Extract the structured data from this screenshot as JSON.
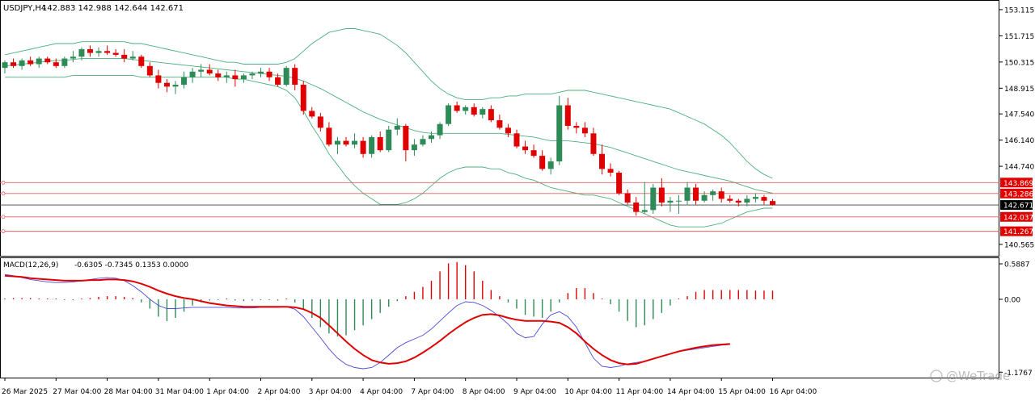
{
  "header": {
    "symbol": "USDJPY,H4",
    "ohlc": "142.883 142.988 142.644 142.671",
    "macd_label": "MACD(12,26,9)",
    "macd_values": "-0.6305 -0.7345 0.1353 0.0000"
  },
  "watermark": "@WeTrade",
  "colors": {
    "bull": "#2e8b57",
    "bear": "#e00000",
    "band": "#4caf7d",
    "signal": "#e00000",
    "macd_line": "#4a4ad8",
    "hline": "#e06060",
    "current_line": "#404040",
    "tag_bg": "#e00000",
    "current_tag_bg": "#000000",
    "grid": "#000000"
  },
  "chart_data": [
    {
      "type": "candlestick",
      "title": "USDJPY,H4",
      "ylim": [
        140.0,
        153.5
      ],
      "y_ticks": [
        "153.115",
        "151.715",
        "150.315",
        "148.915",
        "147.540",
        "146.140",
        "144.740",
        "140.565"
      ],
      "y_tick_values": [
        153.115,
        151.715,
        150.315,
        148.915,
        147.54,
        146.14,
        144.74,
        140.565
      ],
      "x_ticks": [
        "26 Mar 2025",
        "27 Mar 04:00",
        "28 Mar 04:00",
        "31 Mar 04:00",
        "1 Apr 04:00",
        "2 Apr 04:00",
        "3 Apr 04:00",
        "4 Apr 04:00",
        "7 Apr 04:00",
        "8 Apr 04:00",
        "9 Apr 04:00",
        "10 Apr 04:00",
        "11 Apr 04:00",
        "14 Apr 04:00",
        "15 Apr 04:00",
        "16 Apr 04:00"
      ],
      "x_tick_index": [
        0,
        6,
        12,
        18,
        24,
        30,
        36,
        42,
        48,
        54,
        60,
        66,
        72,
        78,
        84,
        90
      ],
      "ohlc": [
        [
          150.0,
          150.4,
          149.7,
          150.3
        ],
        [
          150.3,
          150.5,
          150.0,
          150.1
        ],
        [
          150.1,
          150.5,
          149.9,
          150.4
        ],
        [
          150.4,
          150.6,
          150.1,
          150.2
        ],
        [
          150.2,
          150.6,
          150.0,
          150.5
        ],
        [
          150.5,
          150.6,
          150.2,
          150.3
        ],
        [
          150.3,
          150.5,
          150.0,
          150.1
        ],
        [
          150.1,
          150.6,
          150.0,
          150.5
        ],
        [
          150.5,
          150.9,
          150.3,
          150.6
        ],
        [
          150.6,
          151.1,
          150.4,
          151.0
        ],
        [
          151.0,
          151.2,
          150.6,
          150.8
        ],
        [
          150.8,
          151.1,
          150.6,
          150.9
        ],
        [
          150.9,
          151.2,
          150.7,
          150.8
        ],
        [
          150.8,
          151.0,
          150.6,
          150.7
        ],
        [
          150.7,
          151.0,
          150.3,
          150.5
        ],
        [
          150.5,
          150.9,
          150.4,
          150.6
        ],
        [
          150.6,
          150.7,
          150.0,
          150.1
        ],
        [
          150.1,
          150.3,
          149.5,
          149.6
        ],
        [
          149.6,
          149.9,
          148.9,
          149.2
        ],
        [
          149.2,
          149.4,
          148.7,
          149.0
        ],
        [
          149.0,
          149.3,
          148.6,
          149.1
        ],
        [
          149.1,
          149.8,
          148.9,
          149.5
        ],
        [
          149.5,
          150.0,
          149.2,
          149.8
        ],
        [
          149.8,
          150.2,
          149.5,
          149.9
        ],
        [
          149.9,
          150.2,
          149.6,
          149.7
        ],
        [
          149.7,
          149.9,
          149.3,
          149.5
        ],
        [
          149.5,
          149.8,
          149.2,
          149.6
        ],
        [
          149.6,
          149.9,
          149.0,
          149.4
        ],
        [
          149.4,
          149.7,
          149.2,
          149.6
        ],
        [
          149.6,
          149.8,
          149.4,
          149.7
        ],
        [
          149.7,
          150.0,
          149.5,
          149.8
        ],
        [
          149.8,
          150.0,
          149.3,
          149.5
        ],
        [
          149.5,
          149.7,
          149.0,
          149.1
        ],
        [
          149.1,
          150.1,
          149.0,
          150.0
        ],
        [
          150.0,
          150.2,
          148.8,
          149.1
        ],
        [
          149.1,
          149.3,
          147.5,
          147.7
        ],
        [
          147.7,
          147.9,
          147.3,
          147.4
        ],
        [
          147.4,
          147.6,
          146.6,
          146.8
        ],
        [
          146.8,
          147.1,
          145.8,
          145.9
        ],
        [
          145.9,
          146.3,
          145.4,
          146.1
        ],
        [
          146.1,
          146.3,
          145.8,
          145.9
        ],
        [
          145.9,
          146.5,
          145.7,
          146.1
        ],
        [
          146.1,
          146.3,
          145.2,
          145.4
        ],
        [
          145.4,
          146.4,
          145.2,
          146.3
        ],
        [
          146.3,
          146.6,
          145.5,
          145.6
        ],
        [
          145.6,
          146.9,
          145.5,
          146.7
        ],
        [
          146.7,
          147.3,
          146.4,
          146.9
        ],
        [
          146.9,
          147.0,
          145.0,
          145.6
        ],
        [
          145.6,
          146.2,
          145.3,
          145.9
        ],
        [
          145.9,
          146.4,
          145.8,
          146.2
        ],
        [
          146.2,
          146.6,
          146.0,
          146.4
        ],
        [
          146.4,
          147.1,
          146.2,
          147.0
        ],
        [
          147.0,
          148.1,
          146.9,
          148.0
        ],
        [
          148.0,
          148.2,
          147.6,
          147.7
        ],
        [
          147.7,
          148.0,
          147.5,
          147.9
        ],
        [
          147.9,
          148.1,
          147.4,
          147.5
        ],
        [
          147.5,
          147.9,
          147.3,
          147.8
        ],
        [
          147.8,
          148.0,
          147.1,
          147.2
        ],
        [
          147.2,
          147.5,
          146.7,
          146.8
        ],
        [
          146.8,
          147.0,
          146.3,
          146.5
        ],
        [
          146.5,
          146.7,
          145.7,
          145.8
        ],
        [
          145.8,
          146.1,
          145.4,
          145.6
        ],
        [
          145.6,
          145.9,
          145.2,
          145.3
        ],
        [
          145.3,
          145.6,
          144.5,
          144.6
        ],
        [
          144.6,
          145.2,
          144.3,
          145.0
        ],
        [
          145.0,
          148.5,
          144.8,
          148.0
        ],
        [
          148.0,
          148.4,
          146.7,
          146.9
        ],
        [
          146.9,
          147.1,
          146.5,
          146.8
        ],
        [
          146.8,
          147.1,
          146.3,
          146.5
        ],
        [
          146.5,
          146.8,
          145.3,
          145.4
        ],
        [
          145.4,
          145.9,
          144.3,
          144.6
        ],
        [
          144.6,
          144.9,
          144.2,
          144.4
        ],
        [
          144.4,
          144.5,
          143.2,
          143.3
        ],
        [
          143.3,
          143.5,
          142.7,
          142.8
        ],
        [
          142.8,
          143.1,
          142.1,
          142.3
        ],
        [
          142.3,
          143.9,
          142.2,
          142.4
        ],
        [
          142.4,
          143.8,
          142.2,
          143.6
        ],
        [
          143.6,
          144.1,
          142.6,
          142.8
        ],
        [
          142.8,
          143.1,
          142.3,
          142.9
        ],
        [
          142.9,
          143.2,
          142.2,
          142.9
        ],
        [
          142.9,
          143.9,
          142.7,
          143.6
        ],
        [
          143.6,
          143.8,
          142.7,
          142.9
        ],
        [
          142.9,
          143.4,
          142.8,
          143.2
        ],
        [
          143.2,
          143.5,
          142.9,
          143.4
        ],
        [
          143.4,
          143.6,
          142.8,
          143.0
        ],
        [
          143.0,
          143.2,
          142.8,
          142.9
        ],
        [
          142.9,
          143.0,
          142.6,
          142.8
        ],
        [
          142.8,
          143.2,
          142.6,
          143.0
        ],
        [
          143.0,
          143.3,
          142.8,
          143.1
        ],
        [
          143.1,
          143.2,
          142.7,
          142.9
        ],
        [
          142.883,
          142.988,
          142.644,
          142.671
        ]
      ],
      "bollinger_upper": [
        150.7,
        150.8,
        150.9,
        151.0,
        151.1,
        151.2,
        151.3,
        151.3,
        151.3,
        151.4,
        151.4,
        151.4,
        151.4,
        151.4,
        151.4,
        151.3,
        151.3,
        151.2,
        151.1,
        151.0,
        150.9,
        150.8,
        150.7,
        150.6,
        150.5,
        150.4,
        150.3,
        150.3,
        150.2,
        150.2,
        150.2,
        150.2,
        150.2,
        150.3,
        150.5,
        150.9,
        151.3,
        151.6,
        151.9,
        152.0,
        152.1,
        152.1,
        152.0,
        151.9,
        151.8,
        151.5,
        151.2,
        150.8,
        150.3,
        149.8,
        149.3,
        148.9,
        148.6,
        148.4,
        148.3,
        148.3,
        148.3,
        148.4,
        148.4,
        148.5,
        148.5,
        148.6,
        148.6,
        148.6,
        148.6,
        148.7,
        148.8,
        148.8,
        148.8,
        148.7,
        148.6,
        148.5,
        148.4,
        148.3,
        148.2,
        148.1,
        148.0,
        147.9,
        147.8,
        147.6,
        147.4,
        147.2,
        147.0,
        146.7,
        146.4,
        146.0,
        145.5,
        145.0,
        144.6,
        144.3,
        144.1
      ],
      "bollinger_mid": [
        150.1,
        150.15,
        150.2,
        150.25,
        150.3,
        150.35,
        150.4,
        150.4,
        150.45,
        150.5,
        150.5,
        150.5,
        150.5,
        150.5,
        150.5,
        150.45,
        150.4,
        150.35,
        150.3,
        150.25,
        150.2,
        150.15,
        150.1,
        150.05,
        150.0,
        149.95,
        149.9,
        149.85,
        149.8,
        149.75,
        149.7,
        149.65,
        149.6,
        149.55,
        149.45,
        149.3,
        149.1,
        148.9,
        148.65,
        148.4,
        148.15,
        147.9,
        147.65,
        147.45,
        147.25,
        147.1,
        146.95,
        146.8,
        146.65,
        146.55,
        146.5,
        146.5,
        146.5,
        146.5,
        146.5,
        146.5,
        146.5,
        146.5,
        146.5,
        146.45,
        146.4,
        146.35,
        146.3,
        146.2,
        146.1,
        146.1,
        146.1,
        146.05,
        146.0,
        145.95,
        145.85,
        145.75,
        145.6,
        145.45,
        145.3,
        145.15,
        145.0,
        144.85,
        144.7,
        144.55,
        144.45,
        144.35,
        144.25,
        144.15,
        144.05,
        143.95,
        143.8,
        143.65,
        143.5,
        143.4,
        143.3
      ],
      "bollinger_lower": [
        149.5,
        149.5,
        149.5,
        149.5,
        149.5,
        149.5,
        149.5,
        149.5,
        149.6,
        149.6,
        149.6,
        149.6,
        149.6,
        149.6,
        149.6,
        149.6,
        149.5,
        149.5,
        149.5,
        149.5,
        149.5,
        149.5,
        149.5,
        149.5,
        149.5,
        149.5,
        149.5,
        149.4,
        149.4,
        149.3,
        149.2,
        149.1,
        149.0,
        148.8,
        148.4,
        147.7,
        146.9,
        146.2,
        145.4,
        144.8,
        144.2,
        143.7,
        143.3,
        143.0,
        142.7,
        142.7,
        142.7,
        142.8,
        143.0,
        143.3,
        143.7,
        144.1,
        144.4,
        144.6,
        144.7,
        144.7,
        144.7,
        144.6,
        144.6,
        144.4,
        144.3,
        144.1,
        144.0,
        143.8,
        143.6,
        143.5,
        143.4,
        143.3,
        143.2,
        143.2,
        143.1,
        143.0,
        142.8,
        142.6,
        142.4,
        142.2,
        142.0,
        141.8,
        141.6,
        141.5,
        141.5,
        141.5,
        141.5,
        141.6,
        141.7,
        141.9,
        142.1,
        142.3,
        142.4,
        142.5,
        142.5
      ],
      "horizontal_levels": [
        {
          "label": "143.869",
          "value": 143.869
        },
        {
          "label": "143.286",
          "value": 143.286
        },
        {
          "label": "142.037",
          "value": 142.037
        },
        {
          "label": "141.267",
          "value": 141.267
        }
      ],
      "current_price": {
        "label": "142.671",
        "value": 142.671
      }
    },
    {
      "type": "macd",
      "title": "MACD(12,26,9)",
      "ylim": [
        -1.25,
        0.65
      ],
      "y_ticks": [
        "0.5887",
        "0.00",
        "-1.1767"
      ],
      "y_tick_values": [
        0.5887,
        0.0,
        -1.1767
      ],
      "histogram": [
        0.01,
        0.02,
        0.02,
        0.02,
        0.01,
        0.01,
        0.0,
        -0.01,
        -0.01,
        0.0,
        0.02,
        0.04,
        0.05,
        0.05,
        0.04,
        0.02,
        -0.05,
        -0.15,
        -0.28,
        -0.35,
        -0.3,
        -0.2,
        -0.1,
        -0.05,
        -0.02,
        -0.01,
        0.0,
        -0.02,
        -0.03,
        -0.02,
        -0.01,
        -0.01,
        -0.02,
        0.0,
        -0.05,
        -0.15,
        -0.3,
        -0.45,
        -0.55,
        -0.6,
        -0.58,
        -0.5,
        -0.42,
        -0.32,
        -0.22,
        -0.12,
        -0.03,
        0.05,
        0.12,
        0.2,
        0.3,
        0.45,
        0.58,
        0.6,
        0.55,
        0.45,
        0.3,
        0.15,
        0.05,
        -0.05,
        -0.15,
        -0.25,
        -0.28,
        -0.3,
        -0.2,
        -0.05,
        0.1,
        0.18,
        0.18,
        0.1,
        0.0,
        -0.08,
        -0.2,
        -0.35,
        -0.45,
        -0.42,
        -0.32,
        -0.22,
        -0.1,
        0.0,
        0.05,
        0.12,
        0.15,
        0.15,
        0.15,
        0.15,
        0.15,
        0.15,
        0.14,
        0.14,
        0.14
      ],
      "macd_line": [
        0.4,
        0.38,
        0.35,
        0.32,
        0.3,
        0.28,
        0.27,
        0.27,
        0.28,
        0.3,
        0.32,
        0.34,
        0.35,
        0.34,
        0.3,
        0.22,
        0.12,
        0.0,
        -0.1,
        -0.15,
        -0.15,
        -0.14,
        -0.13,
        -0.13,
        -0.13,
        -0.13,
        -0.13,
        -0.14,
        -0.14,
        -0.14,
        -0.13,
        -0.13,
        -0.13,
        -0.12,
        -0.16,
        -0.28,
        -0.45,
        -0.62,
        -0.8,
        -0.95,
        -1.05,
        -1.1,
        -1.12,
        -1.1,
        -1.02,
        -0.9,
        -0.78,
        -0.7,
        -0.64,
        -0.58,
        -0.48,
        -0.35,
        -0.22,
        -0.1,
        -0.04,
        -0.05,
        -0.1,
        -0.18,
        -0.28,
        -0.4,
        -0.55,
        -0.62,
        -0.6,
        -0.4,
        -0.25,
        -0.2,
        -0.28,
        -0.45,
        -0.7,
        -0.95,
        -1.08,
        -1.1,
        -1.08,
        -1.04,
        -1.02,
        -1.0,
        -0.96,
        -0.92,
        -0.88,
        -0.84,
        -0.82,
        -0.8,
        -0.78,
        -0.76,
        -0.74,
        -0.73
      ],
      "signal_line": [
        0.38,
        0.37,
        0.36,
        0.34,
        0.33,
        0.32,
        0.31,
        0.3,
        0.3,
        0.3,
        0.31,
        0.31,
        0.32,
        0.32,
        0.31,
        0.29,
        0.25,
        0.2,
        0.14,
        0.09,
        0.05,
        0.02,
        0.0,
        -0.03,
        -0.06,
        -0.08,
        -0.1,
        -0.11,
        -0.12,
        -0.12,
        -0.12,
        -0.12,
        -0.12,
        -0.12,
        -0.13,
        -0.16,
        -0.22,
        -0.3,
        -0.42,
        -0.55,
        -0.68,
        -0.8,
        -0.9,
        -0.98,
        -1.02,
        -1.04,
        -1.03,
        -1.0,
        -0.94,
        -0.86,
        -0.77,
        -0.67,
        -0.56,
        -0.46,
        -0.37,
        -0.3,
        -0.25,
        -0.24,
        -0.26,
        -0.3,
        -0.33,
        -0.35,
        -0.35,
        -0.35,
        -0.36,
        -0.38,
        -0.45,
        -0.55,
        -0.68,
        -0.8,
        -0.9,
        -0.98,
        -1.03,
        -1.05,
        -1.04,
        -1.0,
        -0.96,
        -0.92,
        -0.88,
        -0.84,
        -0.81,
        -0.78,
        -0.76,
        -0.74,
        -0.73,
        -0.72
      ],
      "legend": ""
    }
  ]
}
